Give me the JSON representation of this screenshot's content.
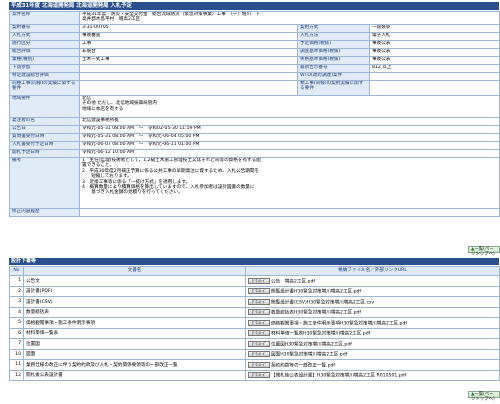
{
  "header": {
    "title": "平成31年度 北海道開発局 北海道開発局 入札予定"
  },
  "details": [
    {
      "label": "案件名称",
      "value": "平成31年度　防災・安全交付金　総合流域防災（緊急対策事業）工事　（一）増川　下\n高井郡木島平村　増高2工区"
    },
    {
      "label": "契約番号",
      "value": "3-31-00705",
      "label2": "契約方式",
      "value2": "一般競争"
    },
    {
      "label": "入札方式",
      "value": "事後審査",
      "label2": "入札方法",
      "value2": "電子入札"
    },
    {
      "label": "施行区分",
      "value": "工事",
      "label2": "予定価格(税抜)",
      "value2": "事後公表"
    },
    {
      "label": "総合評価",
      "value": "非競合",
      "label2": "調査基準価格(税抜)",
      "value2": "事後公表"
    },
    {
      "label": "業種(種別)",
      "value": "土木一式工事",
      "label2": "失格基準価格(税抜)",
      "value2": "事後公表"
    },
    {
      "label": "下請参加",
      "value": "",
      "label2": "最新告示番号",
      "value2": "812 以上"
    },
    {
      "label": "特定建設総合評価",
      "value": "",
      "label2": "WTO(政府調達)案件",
      "value2": ""
    },
    {
      "label": "同種工事(同様)の実績に関する要件",
      "value": "",
      "label2": "類工事(同様)の契約実績に関する要件",
      "value2": ""
    },
    {
      "label": "地域要件",
      "value": "北信\nその他 ただし、北信地域振興局管内\n地域に本店を有する"
    },
    {
      "label": "発注者の名",
      "value": "北信建設事務所長"
    },
    {
      "label": "公告日",
      "value": "令和元-05-31 08:00 AM　～　令和02-05-30 11:59 PM"
    },
    {
      "label": "質問書受付日時",
      "value": "令和元-05-31 08:00 AM　～　令和元-06-04 05:00 PM"
    },
    {
      "label": "入札書受付予定日時",
      "value": "令和元-06-07 08:00 AM　～　令和元-06-11 01:00 PM"
    },
    {
      "label": "開札予定日時",
      "value": "令和元-06-12 10:00 AM"
    },
    {
      "label": "備考",
      "value": "1　主任(監理)技術者として、1,2級土木施工管理技士又はそれと同等の資格を有する配\n置できること。\n2　平成30年度2月補正予算に係る公共工事の早期発注に資するため、入札公告期間を\n　　短縮しております。\n3　近接工事等に係る「一抜け方式」を適用します。\n4　概算数量により積算価格を算出していますので、入札参加者は設計図書の数量に\n　　基づき入札金額の見積りを行ってください。"
    },
    {
      "label": "修正内容履歴",
      "value": ""
    }
  ],
  "buttons": {
    "back_to_top": "一覧(ページトップへ)"
  },
  "files_section": {
    "title": "設計下書等"
  },
  "files": {
    "headers": [
      "No",
      "文書名",
      "格納ファイル名／外部リンクURL"
    ],
    "download_label": "ﾀﾞｳﾝﾛｰﾄﾞ",
    "rows": [
      {
        "no": "1",
        "name": "公告文",
        "file": "公告　増高2工区.pdf"
      },
      {
        "no": "2",
        "name": "設計書(PDF)",
        "file": "関覧設計書H30緊急対策増川増高2工区.pdf"
      },
      {
        "no": "3",
        "name": "設計書(CSV)",
        "file": "関覧設計書(CSV)H30緊急対策増川増高2工区.csv"
      },
      {
        "no": "4",
        "name": "数量総括表",
        "file": "数量総括表H30緊急対策増川増高2工区.pdf"
      },
      {
        "no": "5",
        "name": "価格観閲事項・施工条件明示事項",
        "file": "価格観閲事項・施工条件明示事項H30緊急対策増川増高2工区.pdf"
      },
      {
        "no": "6",
        "name": "材料単価一覧表",
        "file": "材料単価一覧表H30緊急対策増川増高2工区.pdf"
      },
      {
        "no": "7",
        "name": "位置図",
        "file": "位置図H30緊急対策増川増高2工区.pdf"
      },
      {
        "no": "10",
        "name": "図面",
        "file": "図面H30緊急対策増川増高2工区.pdf"
      },
      {
        "no": "11",
        "name": "業務仕様の改正に伴う契約約款及び入札・契約関係要領等の一部改正一覧",
        "file": "契約約款等の一部改正一覧.pdf"
      },
      {
        "no": "12",
        "name": "閲札後公表設計書",
        "file": "【閲札後公表設計書】H30緊急対策増川増高2工区 R010501.pdf"
      }
    ]
  }
}
